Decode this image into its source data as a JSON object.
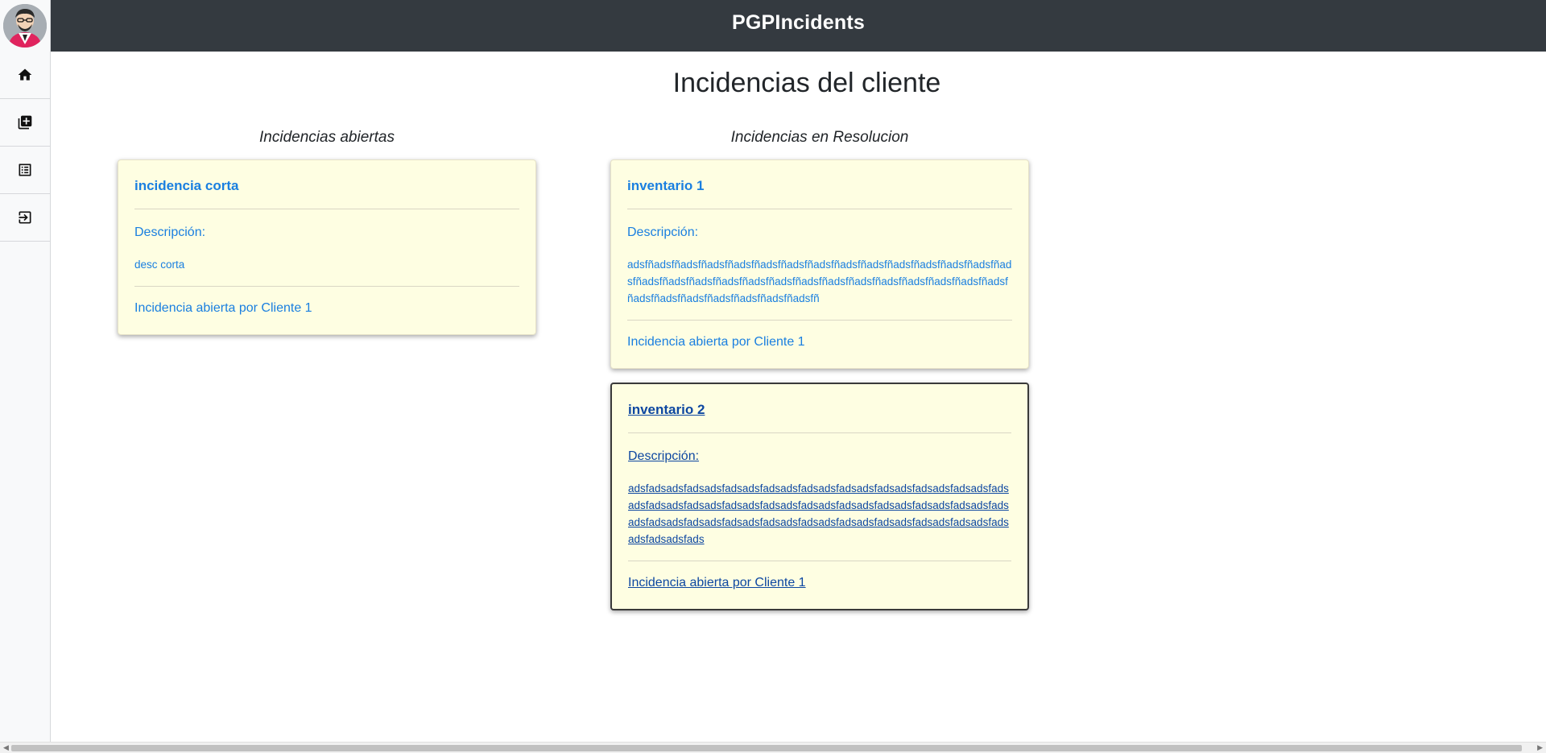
{
  "app": {
    "brand": "PGPIncidents"
  },
  "sidebar": {
    "items": [
      {
        "icon": "home-icon"
      },
      {
        "icon": "add-box-icon"
      },
      {
        "icon": "list-icon"
      },
      {
        "icon": "logout-icon"
      }
    ]
  },
  "page": {
    "title": "Incidencias del cliente"
  },
  "columns": {
    "open": {
      "title": "Incidencias abiertas",
      "cards": [
        {
          "title": "incidencia corta",
          "desc_label": "Descripción:",
          "desc": "desc corta",
          "footer": "Incidencia abierta por Cliente 1"
        }
      ]
    },
    "resolving": {
      "title": "Incidencias en Resolucion",
      "cards": [
        {
          "title": "inventario 1",
          "desc_label": "Descripción:",
          "desc": "adsfñadsfñadsfñadsfñadsfñadsfñadsfñadsfñadsfñadsfñadsfñadsfñadsfñadsfñadsfñadsfñadsfñadsfñadsfñadsfñadsfñadsfñadsfñadsfñadsfñadsfñadsfñadsfñadsfñadsfñadsfñadsfñadsfñadsfñadsfñadsfñ",
          "footer": "Incidencia abierta por Cliente 1"
        },
        {
          "title": "inventario 2",
          "desc_label": "Descripción:",
          "desc": "adsfadsadsfadsadsfadsadsfadsadsfadsadsfadsadsfadsadsfadsadsfadsadsfadsadsfadsadsfadsadsfadsadsfadsadsfadsadsfadsadsfadsadsfadsadsfadsadsfadsadsfadsadsfadsadsfadsadsfadsadsfadsadsfadsadsfadsadsfadsadsfadsadsfadsadsfadsadsfads",
          "footer": "Incidencia abierta por Cliente 1"
        }
      ]
    }
  },
  "colors": {
    "navbar": "#343a40",
    "card_bg": "#fefee2",
    "card_text": "#1a7fe0",
    "card_hover_text": "#0d47a1"
  }
}
